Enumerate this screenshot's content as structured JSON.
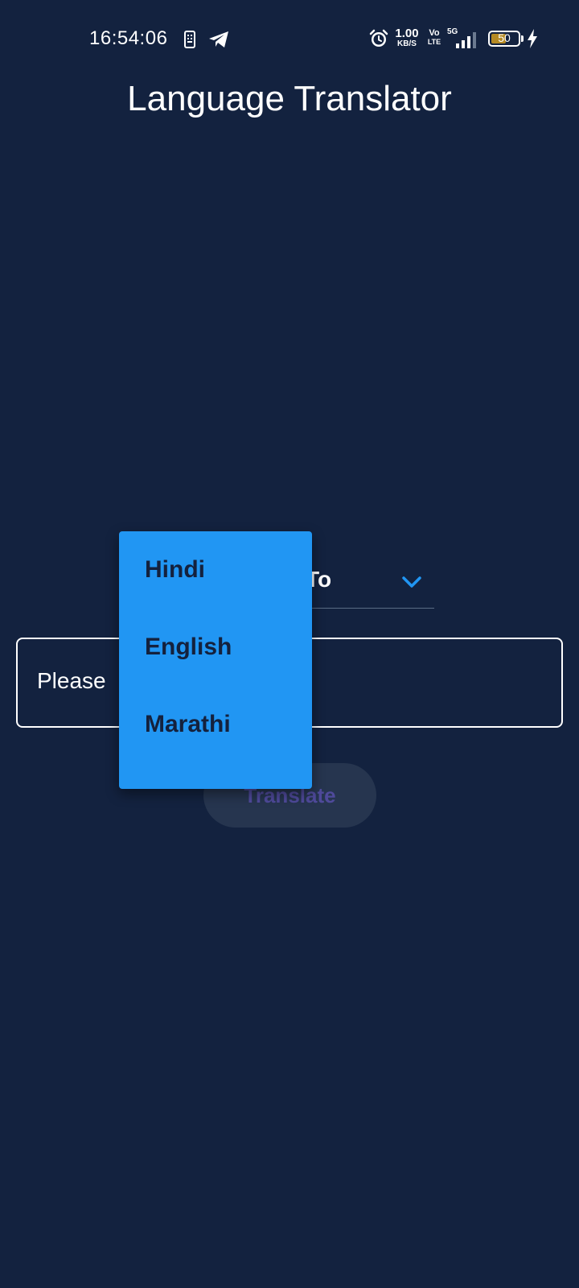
{
  "status_bar": {
    "time": "16:54:06",
    "net_speed_value": "1.00",
    "net_speed_unit": "KB/S",
    "volte_top": "Vo",
    "volte_bottom": "LTE",
    "network_type": "5G",
    "battery_level": "50",
    "icons": [
      "sim-icon",
      "telegram-icon",
      "alarm-icon",
      "signal-icon",
      "battery-icon",
      "charging-bolt-icon"
    ]
  },
  "app": {
    "title": "Language Translator"
  },
  "to_dropdown": {
    "label": "To",
    "icon": "chevron-down-icon"
  },
  "input": {
    "placeholder": "Please"
  },
  "translate_button": {
    "label": "Translate"
  },
  "language_menu": {
    "items": [
      {
        "label": "Hindi"
      },
      {
        "label": "English"
      },
      {
        "label": "Marathi"
      }
    ]
  },
  "colors": {
    "background": "#13223F",
    "menu": "#2196F3",
    "menu_text": "#14213D",
    "accent": "#2196F3",
    "button_bg": "#26354F",
    "button_text": "#4F4A9B"
  }
}
